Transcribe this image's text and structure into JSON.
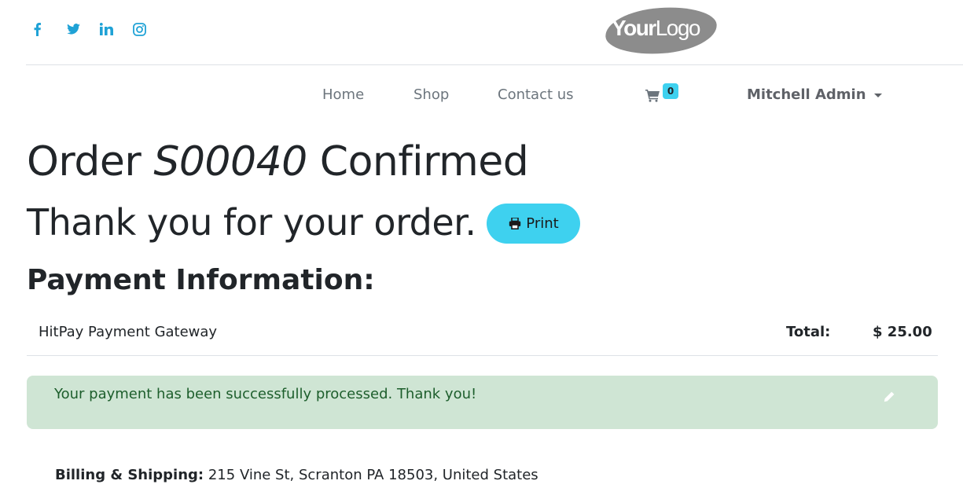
{
  "social": [
    {
      "name": "facebook",
      "glyph": "f"
    },
    {
      "name": "twitter",
      "glyph": "t"
    },
    {
      "name": "linkedin",
      "glyph": "in"
    },
    {
      "name": "instagram",
      "glyph": "ig"
    }
  ],
  "logo": {
    "bold": "Your",
    "light": "Logo"
  },
  "nav": {
    "home": "Home",
    "shop": "Shop",
    "contact": "Contact us",
    "cart_count": "0",
    "user": "Mitchell Admin"
  },
  "order": {
    "prefix": "Order",
    "number": "S00040",
    "suffix": "Confirmed",
    "thanks": "Thank you for your order.",
    "print_label": "Print"
  },
  "payment": {
    "heading": "Payment Information:",
    "method": "HitPay Payment Gateway",
    "total_label": "Total:",
    "total_value": "$ 25.00"
  },
  "alert": {
    "message": "Your payment has been successfully processed. Thank you!"
  },
  "billing": {
    "label": "Billing & Shipping:",
    "address": "215 Vine St, Scranton PA 18503, United States"
  },
  "colors": {
    "accent": "#3ed1ef",
    "social": "#1fa2d6",
    "alert_bg": "#cfe5d4",
    "alert_text": "#1d5e2c"
  }
}
